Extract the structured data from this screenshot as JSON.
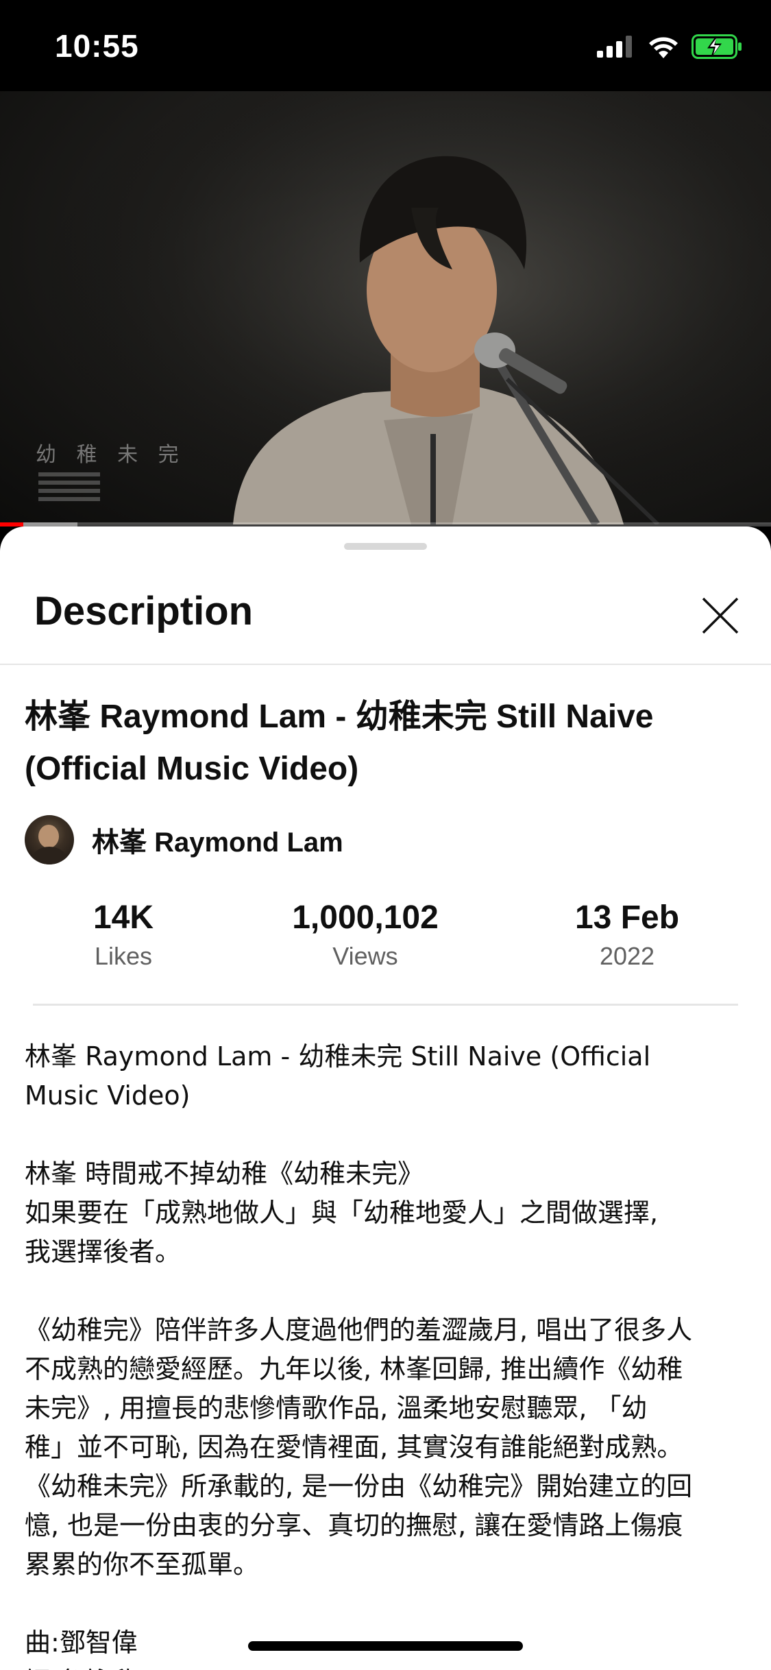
{
  "status_bar": {
    "time": "10:55",
    "icons": [
      "cellular-signal-icon",
      "wifi-icon",
      "battery-charging-icon"
    ],
    "battery_color": "#32d74b"
  },
  "video": {
    "watermark": "幼 稚 未 完",
    "progress_played": 0.03,
    "progress_buffered": 0.1,
    "progress_color": "#ff0000"
  },
  "sheet": {
    "title": "Description",
    "close_icon": "close-icon"
  },
  "details": {
    "video_title": "林峯 Raymond Lam - 幼稚未完 Still Naive (Official Music Video)",
    "channel_name": "林峯 Raymond Lam",
    "stats": {
      "likes_value": "14K",
      "likes_label": "Likes",
      "views_value": "1,000,102",
      "views_label": "Views",
      "date_value": "13 Feb",
      "date_year": "2022"
    },
    "description": "林峯 Raymond Lam - 幼稚未完 Still Naive (Official\nMusic Video)\n\n林峯 時間戒不掉幼稚《幼稚未完》\n如果要在「成熟地做人」與「幼稚地愛人」之間做選擇,\n我選擇後者。\n\n《幼稚完》陪伴許多人度過他們的羞澀歲月, 唱出了很多人\n不成熟的戀愛經歷。九年以後, 林峯回歸, 推出續作《幼稚\n未完》, 用擅長的悲慘情歌作品, 溫柔地安慰聽眾, 「幼\n稚」並不可恥, 因為在愛情裡面, 其實沒有誰能絕對成熟。\n《幼稚未完》所承載的, 是一份由《幼稚完》開始建立的回\n憶, 也是一份由衷的分享、真切的撫慰, 讓在愛情路上傷痕\n累累的你不至孤單。\n\n曲:鄧智偉\n詞:詹詠欣"
  }
}
